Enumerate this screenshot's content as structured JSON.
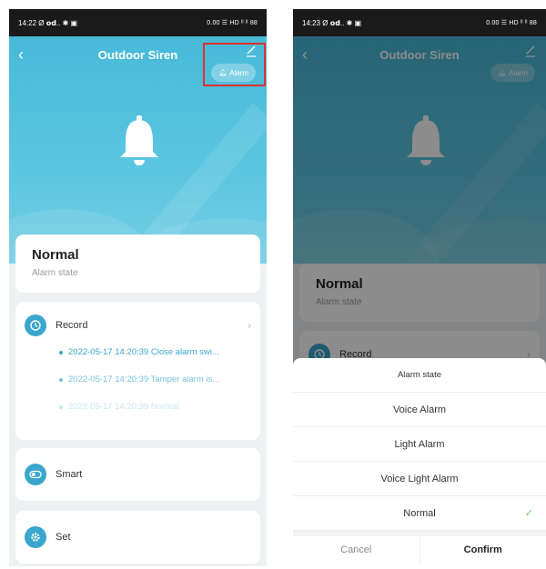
{
  "left": {
    "status": {
      "time": "14:22",
      "icons": "Ø 𝗼𝗱.. ✱ ▣",
      "right": "0.00 ☰ HD ᴵᴵ ᴵᴵ 88"
    },
    "header": {
      "title": "Outdoor Siren",
      "alarm_chip": "Alarm"
    },
    "state": {
      "value": "Normal",
      "label": "Alarm state"
    },
    "record": {
      "label": "Record",
      "items": [
        "2022-05-17 14:20:39 Close alarm swi...",
        "2022-05-17 14:20:39 Tamper alarm is...",
        "2022-05-17 14:20:39 Normal"
      ]
    },
    "smart": {
      "label": "Smart"
    },
    "set": {
      "label": "Set"
    }
  },
  "right": {
    "status": {
      "time": "14:23",
      "icons": "Ø 𝗼𝗱.. ✱ ▣",
      "right": "0.00 ☰ HD ᴵᴵ ᴵᴵ 88"
    },
    "header": {
      "title": "Outdoor Siren",
      "alarm_chip": "Alarm"
    },
    "state": {
      "value": "Normal",
      "label": "Alarm state"
    },
    "record": {
      "label": "Record"
    },
    "sheet": {
      "title": "Alarm state",
      "options": [
        "Voice Alarm",
        "Light Alarm",
        "Voice Light Alarm",
        "Normal"
      ],
      "selected_mark": "✓",
      "cancel": "Cancel",
      "confirm": "Confirm"
    }
  },
  "colors": {
    "accent": "#3aa6cd",
    "hero": "#5cc6e0",
    "highlight": "#e0312e",
    "check": "#5cc96a"
  }
}
